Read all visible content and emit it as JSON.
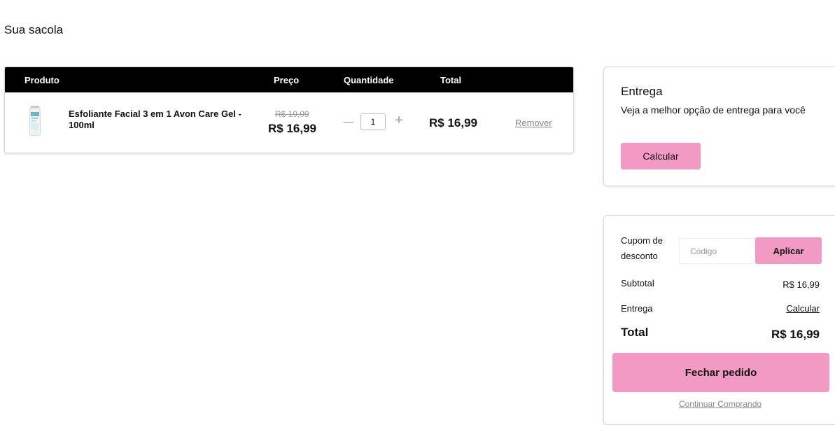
{
  "page": {
    "title": "Sua sacola"
  },
  "cart": {
    "headers": {
      "product": "Produto",
      "price": "Preço",
      "quantity": "Quantidade",
      "total": "Total"
    },
    "items": [
      {
        "name": "Esfoliante Facial 3 em 1 Avon Care Gel - 100ml",
        "old_price": "R$ 19,99",
        "price": "R$ 16,99",
        "quantity": "1",
        "minus_symbol": "—",
        "plus_symbol": "+",
        "total": "R$ 16,99",
        "remove_label": "Remover",
        "image_icon": "product-tube-image"
      }
    ]
  },
  "delivery": {
    "title": "Entrega",
    "description": "Veja a melhor opção de entrega para você",
    "button_label": "Calcular"
  },
  "summary": {
    "coupon_label": "Cupom de desconto",
    "coupon_placeholder": "Código",
    "apply_label": "Aplicar",
    "subtotal_label": "Subtotal",
    "subtotal_value": "R$ 16,99",
    "delivery_label": "Entrega",
    "delivery_value": "Calcular",
    "total_label": "Total",
    "total_value": "R$ 16,99",
    "checkout_label": "Fechar pedido",
    "continue_label": "Continuar Comprando"
  },
  "colors": {
    "accent_pink": "#f29ac3",
    "header_black": "#000000"
  }
}
